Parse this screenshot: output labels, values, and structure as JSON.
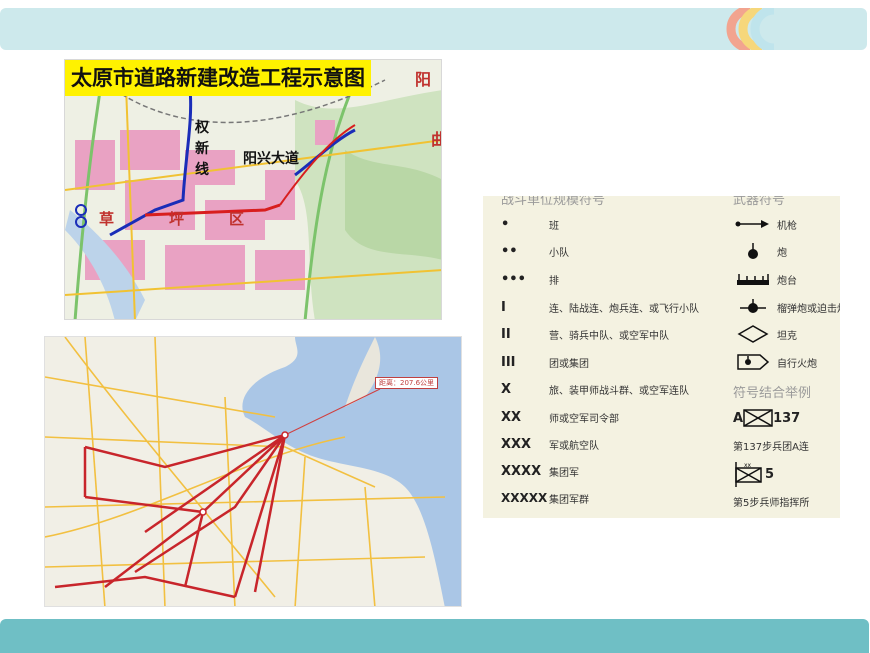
{
  "slide": {
    "top_bar_color": "#cde9ec",
    "bottom_bar_color": "#6fbfc5",
    "arc_colors": [
      "#f2a48f",
      "#f6d77b",
      "#bfe4ec"
    ]
  },
  "map1": {
    "title": "太原市道路新建改造工程示意图",
    "labels": {
      "quanxin": "权新线",
      "yangxing": "阳兴大道",
      "cao": "草",
      "ping": "坪",
      "qu": "区",
      "yang": "阳",
      "qu2": "曲"
    }
  },
  "map2": {
    "callout": "距离：207.6公里"
  },
  "legend": {
    "combat_header": "战斗单位规模符号",
    "weapon_header": "武器符号",
    "units": [
      {
        "symbol": "•",
        "label": "班"
      },
      {
        "symbol": "••",
        "label": "小队"
      },
      {
        "symbol": "•••",
        "label": "排"
      },
      {
        "symbol": "I",
        "label": "连、陆战连、炮兵连、或飞行小队"
      },
      {
        "symbol": "II",
        "label": "营、骑兵中队、或空军中队"
      },
      {
        "symbol": "III",
        "label": "团或集团"
      },
      {
        "symbol": "X",
        "label": "旅、装甲师战斗群、或空军连队"
      },
      {
        "symbol": "XX",
        "label": "师或空军司令部"
      },
      {
        "symbol": "XXX",
        "label": "军或航空队"
      },
      {
        "symbol": "XXXX",
        "label": "集团军"
      },
      {
        "symbol": "XXXXX",
        "label": "集团军群"
      }
    ],
    "weapons": [
      {
        "icon": "machine-gun-icon",
        "label": "机枪"
      },
      {
        "icon": "cannon-icon",
        "label": "炮"
      },
      {
        "icon": "battery-icon",
        "label": "炮台"
      },
      {
        "icon": "mortar-icon",
        "label": "榴弹炮或迫击炮"
      },
      {
        "icon": "tank-icon",
        "label": "坦克"
      },
      {
        "icon": "self-propelled-gun-icon",
        "label": "自行火炮"
      }
    ],
    "combo_header": "符号结合举例",
    "example1": {
      "prefix": "A",
      "number": "137",
      "caption": "第137步兵团A连"
    },
    "example2": {
      "number": "5",
      "caption": "第5步兵师指挥所"
    }
  }
}
